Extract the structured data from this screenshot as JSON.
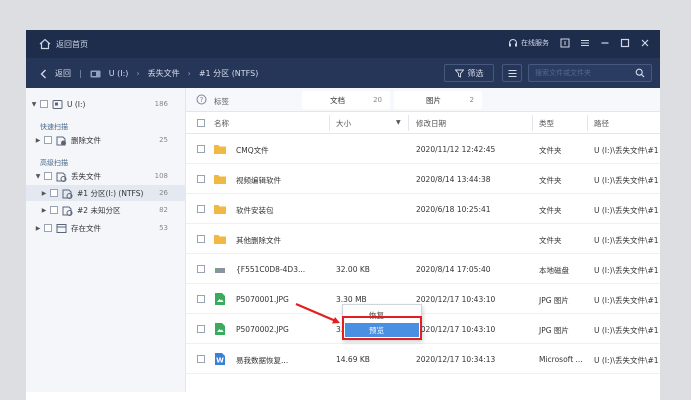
{
  "titlebar": {
    "back_home": "返回首页",
    "service": "在线服务"
  },
  "navbar": {
    "back": "返回",
    "drive": "U (I:)",
    "lost_files": "丢失文件",
    "partition": "#1 分区 (NTFS)",
    "filter": "筛选",
    "search_placeholder": "搜索文件或文件夹"
  },
  "sidebar": {
    "root": {
      "label": "U (I:)",
      "count": "186"
    },
    "quick_scan": "快速扫描",
    "deleted": {
      "label": "删除文件",
      "count": "25"
    },
    "advanced_scan": "高级扫描",
    "lost": {
      "label": "丢失文件",
      "count": "108"
    },
    "partition1": {
      "label": "#1 分区(I:) (NTFS)",
      "count": "26"
    },
    "partition2": {
      "label": "#2 未知分区",
      "count": "82"
    },
    "existing": {
      "label": "存在文件",
      "count": "53"
    }
  },
  "tabs": {
    "tag_label": "标签",
    "items": [
      {
        "label": "文档",
        "count": "20"
      },
      {
        "label": "图片",
        "count": "2"
      }
    ]
  },
  "columns": {
    "name": "名称",
    "size": "大小",
    "modified": "修改日期",
    "type": "类型",
    "path": "路径"
  },
  "rows": [
    {
      "name": "CMQ文件",
      "size": "",
      "date": "2020/11/12 12:42:45",
      "type": "文件夹",
      "path": "U (I:)\\丢失文件\\#1 分..."
    },
    {
      "name": "视频编辑软件",
      "size": "",
      "date": "2020/8/14 13:44:38",
      "type": "文件夹",
      "path": "U (I:)\\丢失文件\\#1 分..."
    },
    {
      "name": "软件安装包",
      "size": "",
      "date": "2020/6/18 10:25:41",
      "type": "文件夹",
      "path": "U (I:)\\丢失文件\\#1 分..."
    },
    {
      "name": "其他删除文件",
      "size": "",
      "date": "",
      "type": "文件夹",
      "path": "U (I:)\\丢失文件\\#1 分..."
    },
    {
      "name": "{F551C0D8-4D3...",
      "size": "32.00 KB",
      "date": "2020/8/14 17:05:40",
      "type": "本地磁盘",
      "path": "U (I:)\\丢失文件\\#1 分..."
    },
    {
      "name": "P5070001.JPG",
      "size": "3.30 MB",
      "date": "2020/12/17 10:43:10",
      "type": "JPG 图片",
      "path": "U (I:)\\丢失文件\\#1 分..."
    },
    {
      "name": "P5070002.JPG",
      "size": "3.19 MB",
      "date": "2020/12/17 10:43:10",
      "type": "JPG 图片",
      "path": "U (I:)\\丢失文件\\#1 分..."
    },
    {
      "name": "易我数据恢复...",
      "size": "14.69 KB",
      "date": "2020/12/17 10:34:13",
      "type": "Microsoft ...",
      "path": "U (I:)\\丢失文件\\#1 分..."
    }
  ],
  "context_menu": {
    "recover": "恢复",
    "preview": "预览"
  },
  "colors": {
    "titlebar": "#1f2d4c",
    "navbar": "#263659",
    "highlight": "#4a90e2",
    "folder": "#f2b844",
    "red_annotation": "#e02020"
  }
}
